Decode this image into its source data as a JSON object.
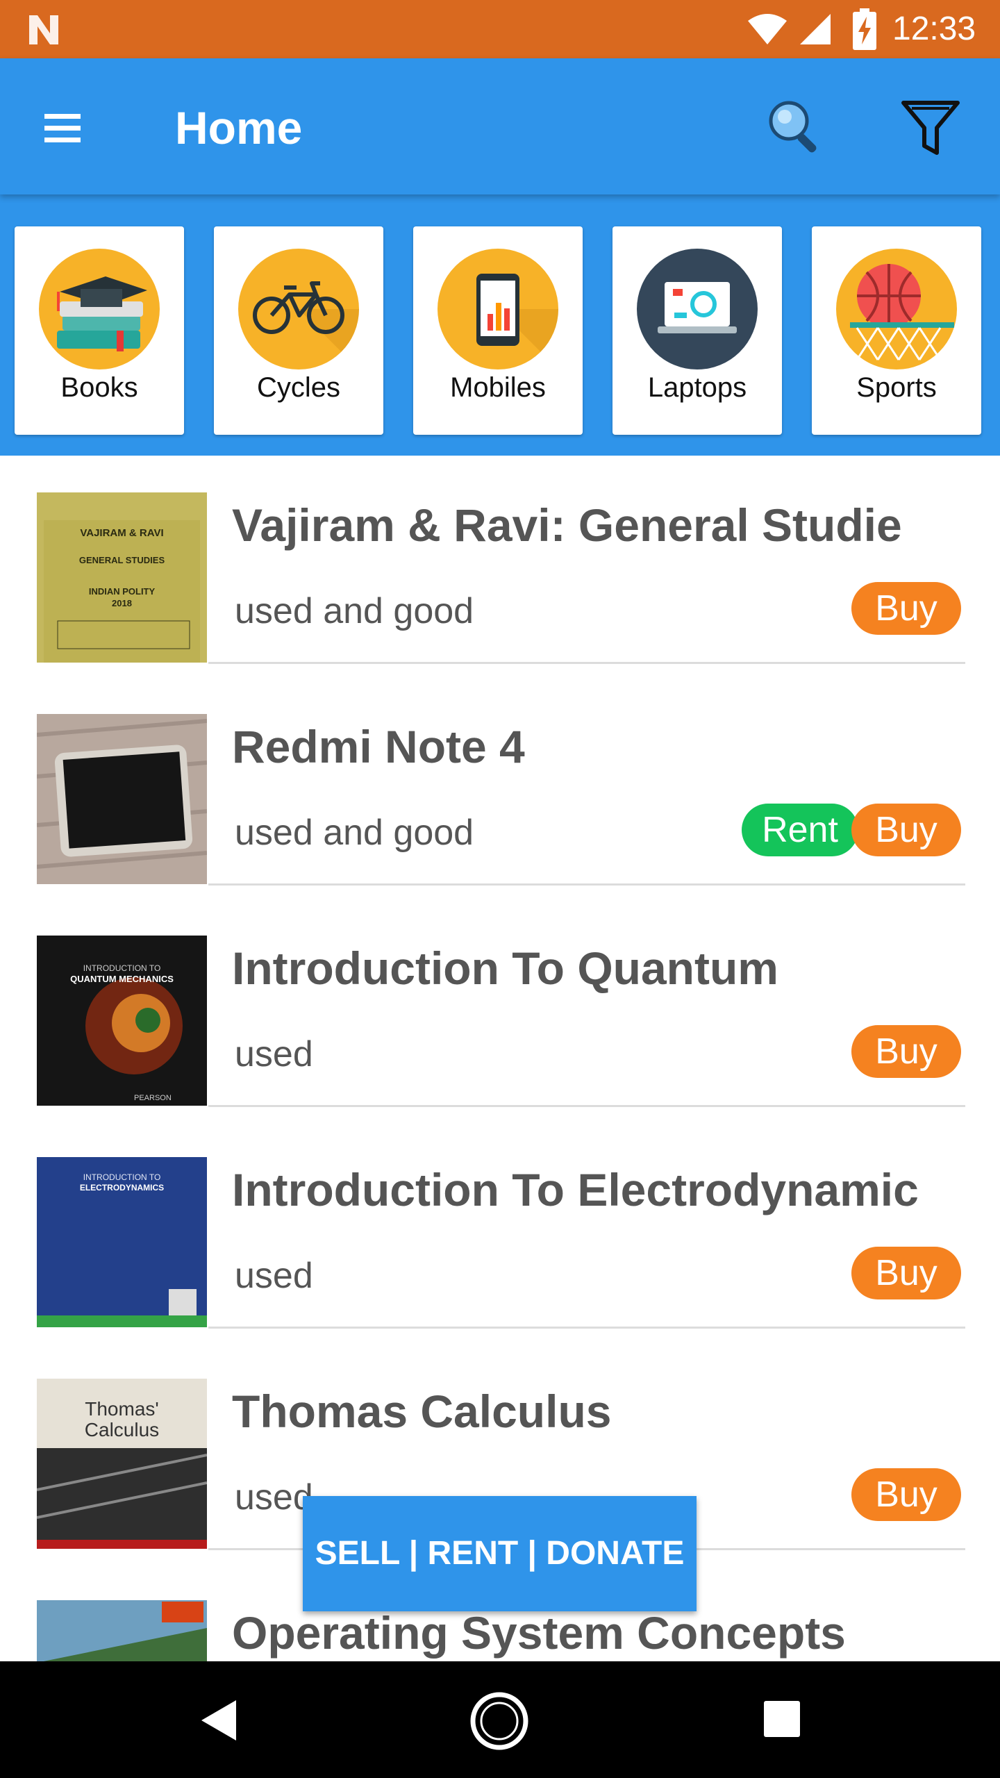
{
  "status_bar": {
    "time": "12:33",
    "icons": [
      "notification-n-icon",
      "wifi-icon",
      "cell-signal-icon",
      "battery-charging-icon"
    ]
  },
  "app_bar": {
    "title": "Home",
    "icons": [
      "hamburger-menu-icon",
      "search-icon",
      "filter-icon"
    ]
  },
  "categories": [
    {
      "label": "Books",
      "icon": "books-icon"
    },
    {
      "label": "Cycles",
      "icon": "bicycle-icon"
    },
    {
      "label": "Mobiles",
      "icon": "mobile-phone-icon"
    },
    {
      "label": "Laptops",
      "icon": "laptop-icon"
    },
    {
      "label": "Sports",
      "icon": "basketball-icon"
    }
  ],
  "listings": [
    {
      "title": "Vajiram & Ravi: General Studie",
      "condition": "used and good",
      "rent": null,
      "buy": "Buy"
    },
    {
      "title": "Redmi Note 4",
      "condition": "used and good",
      "rent": "Rent",
      "buy": "Buy"
    },
    {
      "title": "Introduction To Quantum",
      "condition": "used",
      "rent": null,
      "buy": "Buy"
    },
    {
      "title": "Introduction To Electrodynamic",
      "condition": "used",
      "rent": null,
      "buy": "Buy"
    },
    {
      "title": "Thomas Calculus",
      "condition": "used",
      "rent": null,
      "buy": "Buy"
    },
    {
      "title": "Operating System Concepts",
      "condition": "",
      "rent": null,
      "buy": ""
    }
  ],
  "thumb_text": {
    "vajiram": [
      "VAJIRAM & RAVI",
      "GENERAL STUDIES",
      "INDIAN POLITY",
      "2018"
    ],
    "quantum": [
      "INTRODUCTION TO",
      "QUANTUM MECHANICS",
      "PEARSON"
    ],
    "electro": [
      "INTRODUCTION TO",
      "ELECTRODYNAMICS"
    ],
    "thomas": [
      "Thomas'",
      "Calculus"
    ]
  },
  "fab": {
    "label": "SELL | RENT | DONATE"
  },
  "colors": {
    "status_bar": "#d9691f",
    "primary": "#2f94ea",
    "buy": "#f58220",
    "rent": "#14c45a"
  }
}
